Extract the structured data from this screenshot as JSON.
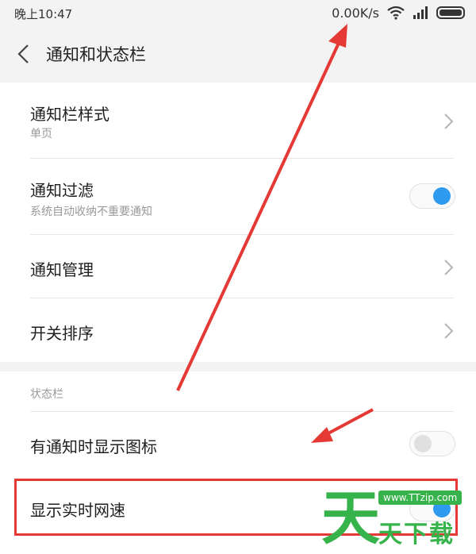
{
  "status_bar": {
    "time": "晚上10:47",
    "net_speed": "0.00K/s",
    "icons": [
      "wifi-icon",
      "signal-icon",
      "battery-icon"
    ]
  },
  "header": {
    "back_icon": "chevron-left-icon",
    "title": "通知和状态栏"
  },
  "notification_section": {
    "items": [
      {
        "title": "通知栏样式",
        "subtitle": "单页",
        "control": "chevron"
      },
      {
        "title": "通知过滤",
        "subtitle": "系统自动收纳不重要通知",
        "control": "toggle",
        "on": true
      },
      {
        "title": "通知管理",
        "control": "chevron"
      },
      {
        "title": "开关排序",
        "control": "chevron"
      }
    ]
  },
  "status_section": {
    "header": "状态栏",
    "items": [
      {
        "title": "有通知时显示图标",
        "control": "toggle",
        "on": false
      },
      {
        "title": "显示实时网速",
        "control": "toggle",
        "on": true
      }
    ]
  },
  "annotation": {
    "highlight_color": "#e53935",
    "arrow_color": "#e53935"
  },
  "watermark": {
    "url": "www.TTzip.com",
    "big_char": "天",
    "text": "天下载",
    "color": "#36b34a"
  },
  "colors": {
    "accent": "#2e9bf0",
    "background": "#f3f3f3"
  }
}
